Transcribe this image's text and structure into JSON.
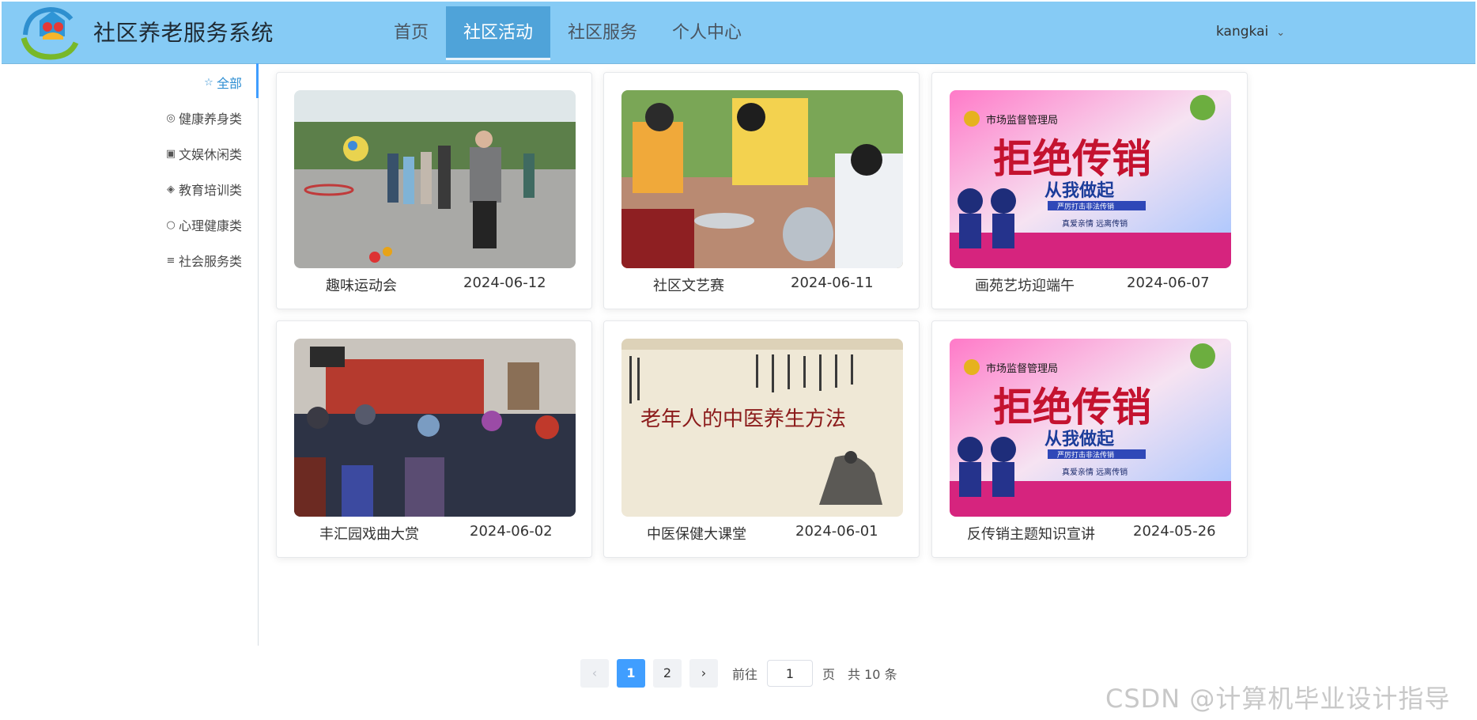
{
  "app": {
    "title": "社区养老服务系统"
  },
  "nav": {
    "items": [
      {
        "label": "首页"
      },
      {
        "label": "社区活动"
      },
      {
        "label": "社区服务"
      },
      {
        "label": "个人中心"
      }
    ],
    "active": "社区活动"
  },
  "user": {
    "name": "kangkai"
  },
  "sidebar": {
    "items": [
      {
        "label": "全部",
        "icon": "star-icon"
      },
      {
        "label": "健康养身类",
        "icon": "medal-icon"
      },
      {
        "label": "文娱休闲类",
        "icon": "sofa-icon"
      },
      {
        "label": "教育培训类",
        "icon": "graduation-icon"
      },
      {
        "label": "心理健康类",
        "icon": "chat-icon"
      },
      {
        "label": "社会服务类",
        "icon": "sliders-icon"
      }
    ],
    "active": "全部"
  },
  "activities": [
    {
      "title": "趣味运动会",
      "date": "2024-06-12",
      "image": "outdoor-sports-photo"
    },
    {
      "title": "社区文艺赛",
      "date": "2024-06-11",
      "image": "volunteers-photo"
    },
    {
      "title": "画苑艺坊迎端午",
      "date": "2024-06-07",
      "image": "anti-mlm-poster",
      "poster": {
        "org": "市场监督管理局",
        "line1": "拒绝传销",
        "line2": "从我做起",
        "line3": "严厉打击非法传销",
        "line4": "真爱亲情 远离传销"
      }
    },
    {
      "title": "丰汇园戏曲大赏",
      "date": "2024-06-02",
      "image": "opera-audience-photo"
    },
    {
      "title": "中医保健大课堂",
      "date": "2024-06-01",
      "image": "tcm-poster",
      "poster": {
        "line1": "老年人的中医养生方法"
      }
    },
    {
      "title": "反传销主题知识宣讲",
      "date": "2024-05-26",
      "image": "anti-mlm-poster",
      "poster": {
        "org": "市场监督管理局",
        "line1": "拒绝传销",
        "line2": "从我做起",
        "line3": "严厉打击非法传销",
        "line4": "真爱亲情 远离传销"
      }
    }
  ],
  "pagination": {
    "prev_icon": "chevron-left-icon",
    "next_icon": "chevron-right-icon",
    "pages": [
      "1",
      "2"
    ],
    "current": "1",
    "goto_label": "前往",
    "goto_value": "1",
    "page_label": "页",
    "total_label": "共 10 条"
  },
  "watermark": "CSDN @计算机毕业设计指导"
}
